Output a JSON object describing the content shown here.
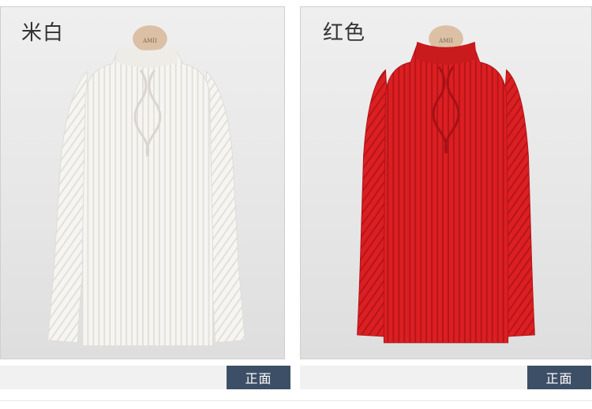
{
  "products": [
    {
      "color_label": "米白",
      "view_label": "正面",
      "sweater_color": "#f6f5f1",
      "rib_color": "#e2e0da",
      "hanger_tag": "AMII"
    },
    {
      "color_label": "红色",
      "view_label": "正面",
      "sweater_color": "#dc1f22",
      "rib_color": "#b51519",
      "hanger_tag": "AMII"
    }
  ]
}
